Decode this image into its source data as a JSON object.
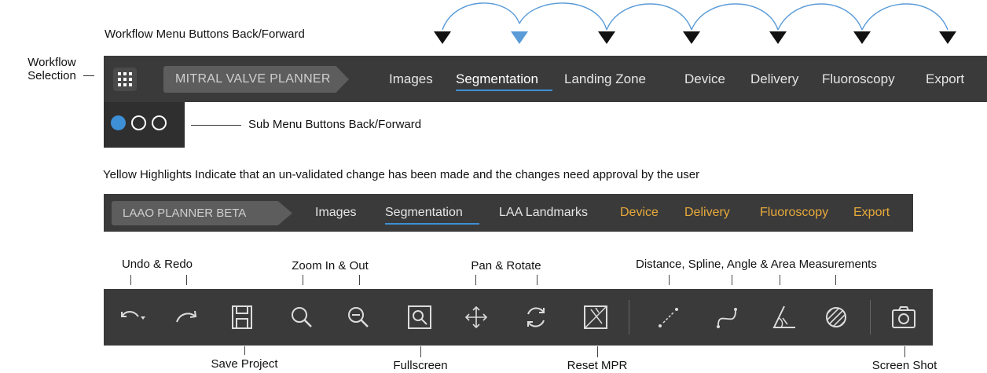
{
  "annotations": {
    "workflow_buttons": "Workflow Menu Buttons Back/Forward",
    "workflow_selection_1": "Workflow",
    "workflow_selection_2": "Selection",
    "sub_menu": "Sub Menu Buttons Back/Forward",
    "yellow_note": "Yellow Highlights Indicate that an un-validated change has been made and the changes need approval by the user",
    "undo_redo": "Undo & Redo",
    "zoom": "Zoom In & Out",
    "pan_rotate": "Pan & Rotate",
    "measurements": "Distance, Spline, Angle & Area Measurements",
    "save_project": "Save Project",
    "fullscreen": "Fullscreen",
    "reset_mpr": "Reset MPR",
    "screen_shot": "Screen Shot"
  },
  "workflow_bar": {
    "planner": "MITRAL VALVE PLANNER",
    "tabs": [
      {
        "label": "Images"
      },
      {
        "label": "Segmentation",
        "selected": true
      },
      {
        "label": "Landing Zone"
      },
      {
        "label": "Device"
      },
      {
        "label": "Delivery"
      },
      {
        "label": "Fluoroscopy"
      },
      {
        "label": "Export"
      }
    ]
  },
  "sub_menu": {
    "active_index": 0,
    "count": 3
  },
  "laao_bar": {
    "planner": "LAAO PLANNER BETA",
    "tabs": [
      {
        "label": "Images"
      },
      {
        "label": "Segmentation",
        "selected": true
      },
      {
        "label": "LAA Landmarks"
      },
      {
        "label": "Device",
        "unvalidated": true
      },
      {
        "label": "Delivery",
        "unvalidated": true
      },
      {
        "label": "Fluoroscopy",
        "unvalidated": true
      },
      {
        "label": "Export",
        "unvalidated": true
      }
    ]
  },
  "toolbar_icons": [
    "undo-icon",
    "redo-icon",
    "save-icon",
    "zoom-in-icon",
    "zoom-out-icon",
    "fullscreen-icon",
    "pan-icon",
    "rotate-icon",
    "reset-mpr-icon",
    "distance-icon",
    "spline-icon",
    "angle-icon",
    "area-icon",
    "camera-icon"
  ],
  "colors": {
    "bar": "#3a3a3a",
    "accent_blue": "#3d8fd6",
    "warning_yellow": "#e8a93a",
    "arrow_blue": "#5a9bd8"
  }
}
